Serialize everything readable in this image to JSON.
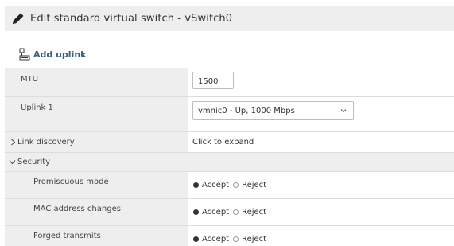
{
  "dialog": {
    "title": "Edit standard virtual switch - vSwitch0",
    "title_icon": "pencil-icon"
  },
  "toolbar": {
    "add_uplink_label": "Add uplink",
    "add_uplink_icon": "network-adapter-icon"
  },
  "properties": {
    "mtu": {
      "label": "MTU",
      "value": "1500"
    },
    "uplink1": {
      "label": "Uplink 1",
      "value": "vmnic0 - Up, 1000 Mbps"
    },
    "link_discovery": {
      "label": "Link discovery",
      "value": "Click to expand",
      "expanded": false
    },
    "security": {
      "label": "Security",
      "expanded": true,
      "promiscuous_mode": {
        "label": "Promiscuous mode",
        "accept": "Accept",
        "reject": "Reject",
        "selected": "Accept"
      },
      "mac_address_changes": {
        "label": "MAC address changes",
        "accept": "Accept",
        "reject": "Reject",
        "selected": "Accept"
      },
      "forged_transmits": {
        "label": "Forged transmits",
        "accept": "Accept",
        "reject": "Reject",
        "selected": "Accept"
      }
    }
  },
  "colors": {
    "label_background": "#eeeeee",
    "link_accent": "#35627f",
    "border": "#dcdcdc"
  }
}
